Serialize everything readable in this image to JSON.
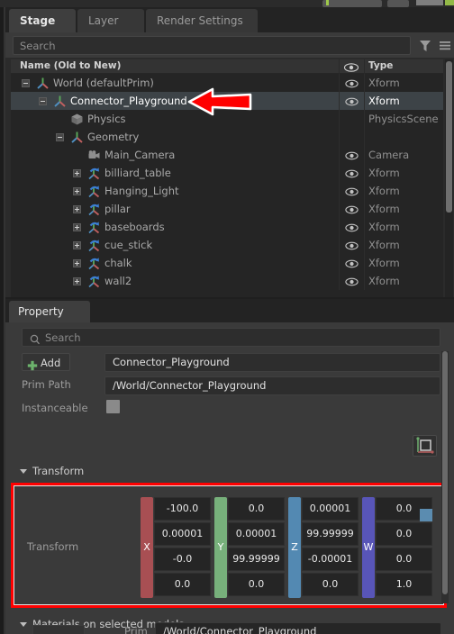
{
  "stage_panel": {
    "tabs": [
      {
        "id": "stage",
        "label": "Stage",
        "active": true
      },
      {
        "id": "layer",
        "label": "Layer",
        "active": false
      },
      {
        "id": "render",
        "label": "Render Settings",
        "active": false
      }
    ],
    "search": {
      "placeholder": "Search",
      "value": ""
    },
    "toolbar_icons": [
      "filter-icon",
      "menu-icon"
    ],
    "columns": {
      "name": "Name (Old to New)",
      "visibility": "eye-icon",
      "type": "Type"
    },
    "tree": [
      {
        "name": "World (defaultPrim)",
        "type": "Xform",
        "depth": 0,
        "expander": "minus",
        "icon": "xform-axis-icon",
        "eye": true,
        "selected": false
      },
      {
        "name": "Connector_Playground",
        "type": "Xform",
        "depth": 1,
        "expander": "minus",
        "icon": "xform-axis-icon",
        "eye": true,
        "selected": true
      },
      {
        "name": "Physics",
        "type": "PhysicsScene",
        "depth": 2,
        "expander": "none",
        "icon": "cube-icon",
        "eye": false,
        "selected": false
      },
      {
        "name": "Geometry",
        "type": "",
        "depth": 2,
        "expander": "minus",
        "icon": "xform-axis-icon",
        "eye": false,
        "selected": false
      },
      {
        "name": "Main_Camera",
        "type": "Camera",
        "depth": 3,
        "expander": "none",
        "icon": "camera-icon",
        "eye": true,
        "selected": false
      },
      {
        "name": "billiard_table",
        "type": "Xform",
        "depth": 3,
        "expander": "plus",
        "icon": "xform-reference-icon",
        "eye": true,
        "selected": false
      },
      {
        "name": "Hanging_Light",
        "type": "Xform",
        "depth": 3,
        "expander": "plus",
        "icon": "xform-reference-icon",
        "eye": true,
        "selected": false
      },
      {
        "name": "pillar",
        "type": "Xform",
        "depth": 3,
        "expander": "plus",
        "icon": "xform-reference-icon",
        "eye": true,
        "selected": false
      },
      {
        "name": "baseboards",
        "type": "Xform",
        "depth": 3,
        "expander": "plus",
        "icon": "xform-reference-icon",
        "eye": true,
        "selected": false
      },
      {
        "name": "cue_stick",
        "type": "Xform",
        "depth": 3,
        "expander": "plus",
        "icon": "xform-reference-icon",
        "eye": true,
        "selected": false
      },
      {
        "name": "chalk",
        "type": "Xform",
        "depth": 3,
        "expander": "plus",
        "icon": "xform-reference-icon",
        "eye": true,
        "selected": false
      },
      {
        "name": "wall2",
        "type": "Xform",
        "depth": 3,
        "expander": "plus",
        "icon": "xform-reference-icon",
        "eye": true,
        "selected": false
      }
    ]
  },
  "property_panel": {
    "tab_label": "Property",
    "search": {
      "placeholder": "Search",
      "value": ""
    },
    "add_button_label": "Add",
    "prim_name_value": "Connector_Playground",
    "prim_path_label": "Prim Path",
    "prim_path_value": "/World/Connector_Playground",
    "instanceable_label": "Instanceable",
    "instanceable_checked": false,
    "transform_section": {
      "title": "Transform",
      "row_label": "Transform",
      "gizmo_icon": "axis-gizmo-icon",
      "columns": [
        {
          "axis": "X",
          "color": "#a84f53",
          "values": [
            "-100.0",
            "0.00001",
            "-0.0",
            "0.0"
          ]
        },
        {
          "axis": "Y",
          "color": "#77b07b",
          "values": [
            "0.0",
            "0.00001",
            "99.99999",
            "0.0"
          ]
        },
        {
          "axis": "Z",
          "color": "#5389b2",
          "values": [
            "0.00001",
            "99.99999",
            "-0.00001",
            "0.0"
          ]
        },
        {
          "axis": "W",
          "color": "#5855b8",
          "values": [
            "0.0",
            "0.0",
            "0.0",
            "1.0"
          ]
        }
      ]
    },
    "materials_section": {
      "title": "Materials on selected models",
      "prim_label": "Prim",
      "prim_value": "/World/Connector_Playground"
    }
  },
  "annotation": {
    "arrow": "red-left-arrow",
    "color": "#ff0000",
    "points_at": "Connector_Playground"
  }
}
